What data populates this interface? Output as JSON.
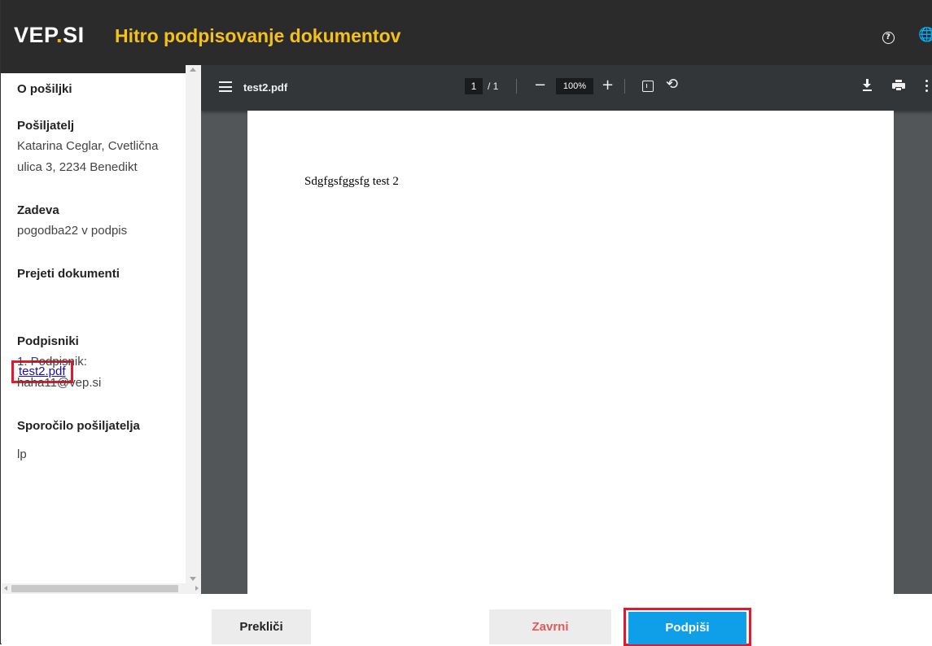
{
  "header": {
    "logo_main": "VEP",
    "logo_dot": ".",
    "logo_suffix": "SI",
    "title": "Hitro podpisovanje dokumentov",
    "help_glyph": "?",
    "globe_glyph": "🌐",
    "icons": [
      "help-icon",
      "globe-icon"
    ]
  },
  "sidebar": {
    "heading": "O pošiljki",
    "sender_label": "Pošiljatelj",
    "sender_line1": "Katarina Ceglar, Cvetlična",
    "sender_line2": "ulica 3, 2234 Benedikt",
    "subject_label": "Zadeva",
    "subject_value": "pogodba22 v podpis",
    "documents_label": "Prejeti dokumenti",
    "document_link": "test2.pdf",
    "signers_label": "Podpisniki",
    "signer_line1": "1. Podpisnik:",
    "signer_line2": "haha11@vep.si",
    "message_label": "Sporočilo pošiljatelja",
    "message_value": "lp"
  },
  "viewer": {
    "filename": "test2.pdf",
    "current_page": "1",
    "page_total": "/ 1",
    "zoom": "100%",
    "zoom_out_glyph": "−",
    "zoom_in_glyph": "+",
    "rotate_glyph": "⟲",
    "page_content": "Sdgfgsfggsfg  test 2",
    "icons": [
      "menu-icon",
      "fit-page-icon",
      "rotate-icon",
      "download-icon",
      "print-icon",
      "more-icon"
    ]
  },
  "footer": {
    "cancel_label": "Prekliči",
    "reject_label": "Zavrni",
    "sign_label": "Podpiši"
  },
  "colors": {
    "header_bg": "#2b2b2b",
    "title_accent": "#f5c01a",
    "sign_button": "#0f9ee8",
    "reject_text": "#e35a5a",
    "highlight_outline": "#e0192d",
    "viewer_bg": "#525659",
    "toolbar_bg": "#323639"
  }
}
